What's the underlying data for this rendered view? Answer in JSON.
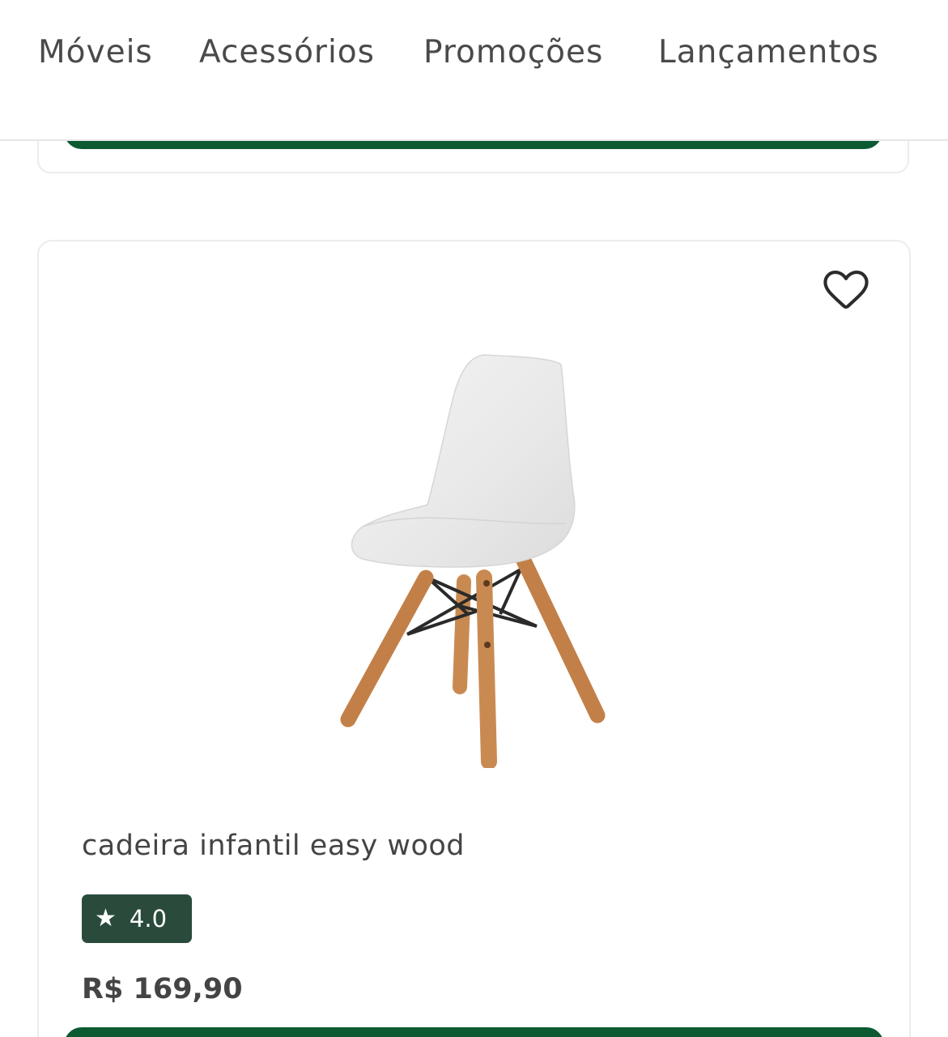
{
  "nav": {
    "items": [
      {
        "label": "Móveis"
      },
      {
        "label": "Acessórios"
      },
      {
        "label": "Promoções"
      },
      {
        "label": "Lançamentos"
      }
    ]
  },
  "product": {
    "name": "cadeira infantil easy wood",
    "rating": "4.0",
    "price": "R$ 169,90",
    "favorite_icon": "heart-outline-icon",
    "rating_icon": "star-icon"
  },
  "colors": {
    "primary_green": "#0b5a32",
    "badge_green": "#2a4b3c",
    "text": "#444444"
  }
}
